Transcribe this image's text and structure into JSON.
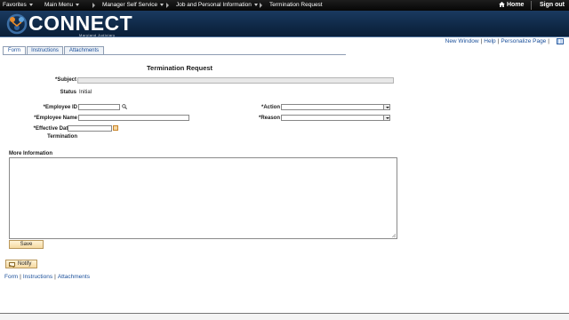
{
  "topnav": {
    "favorites": "Favorites",
    "main_menu": "Main Menu",
    "breadcrumb_1": "Manager Self Service",
    "breadcrumb_2": "Job and Personal Information",
    "breadcrumb_3": "Termination Request",
    "home": "Home",
    "sign_out": "Sign out"
  },
  "banner": {
    "logo_text": "CONNECT",
    "logo_subtext": "Maryland Judiciary"
  },
  "pagelinks": {
    "new_window": "New Window",
    "help": "Help",
    "personalize": "Personalize Page",
    "separator": "|"
  },
  "tabs": [
    "Form",
    "Instructions",
    "Attachments"
  ],
  "form": {
    "title": "Termination Request",
    "subject_label": "*Subject",
    "status_label": "Status",
    "status_value": "Initial",
    "employee_id_label": "*Employee ID",
    "employee_id_value": "",
    "employee_name_label": "*Employee Name",
    "employee_name_value": "",
    "effective_date_label_1": "*Effective Date of",
    "effective_date_label_2": "Termination",
    "effective_date_value": "",
    "action_label": "*Action",
    "action_value": "",
    "reason_label": "*Reason",
    "reason_value": "",
    "more_info_label": "More Information",
    "more_info_value": ""
  },
  "buttons": {
    "save": "Save",
    "notify": "Notify"
  },
  "footer_links": [
    "Form",
    "Instructions",
    "Attachments"
  ],
  "colors": {
    "banner": "#0f2846",
    "link": "#1a4f9a",
    "button": "#f5d9a1"
  }
}
